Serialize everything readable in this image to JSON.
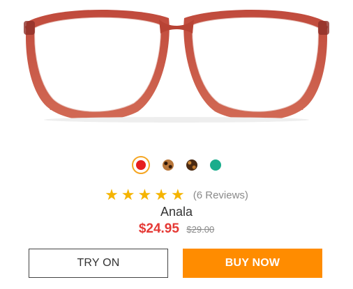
{
  "product": {
    "name": "Anala",
    "price": "$24.95",
    "original_price": "$29.00",
    "image_icon": "glasses-image"
  },
  "colors": [
    {
      "name": "red",
      "hex": "#e61e1e",
      "selected": true
    },
    {
      "name": "tortoise-light",
      "hex": "#b9773a",
      "selected": false
    },
    {
      "name": "tortoise-dark",
      "hex": "#6b3a12",
      "selected": false
    },
    {
      "name": "teal",
      "hex": "#19ad8c",
      "selected": false
    }
  ],
  "rating": {
    "stars": 5,
    "max_stars": 5,
    "reviews_text": "(6 Reviews)"
  },
  "buttons": {
    "try_on": "TRY ON",
    "buy_now": "BUY NOW"
  },
  "theme": {
    "accent": "#ff8c00",
    "price_color": "#e53935",
    "star_color": "#f5b400"
  }
}
